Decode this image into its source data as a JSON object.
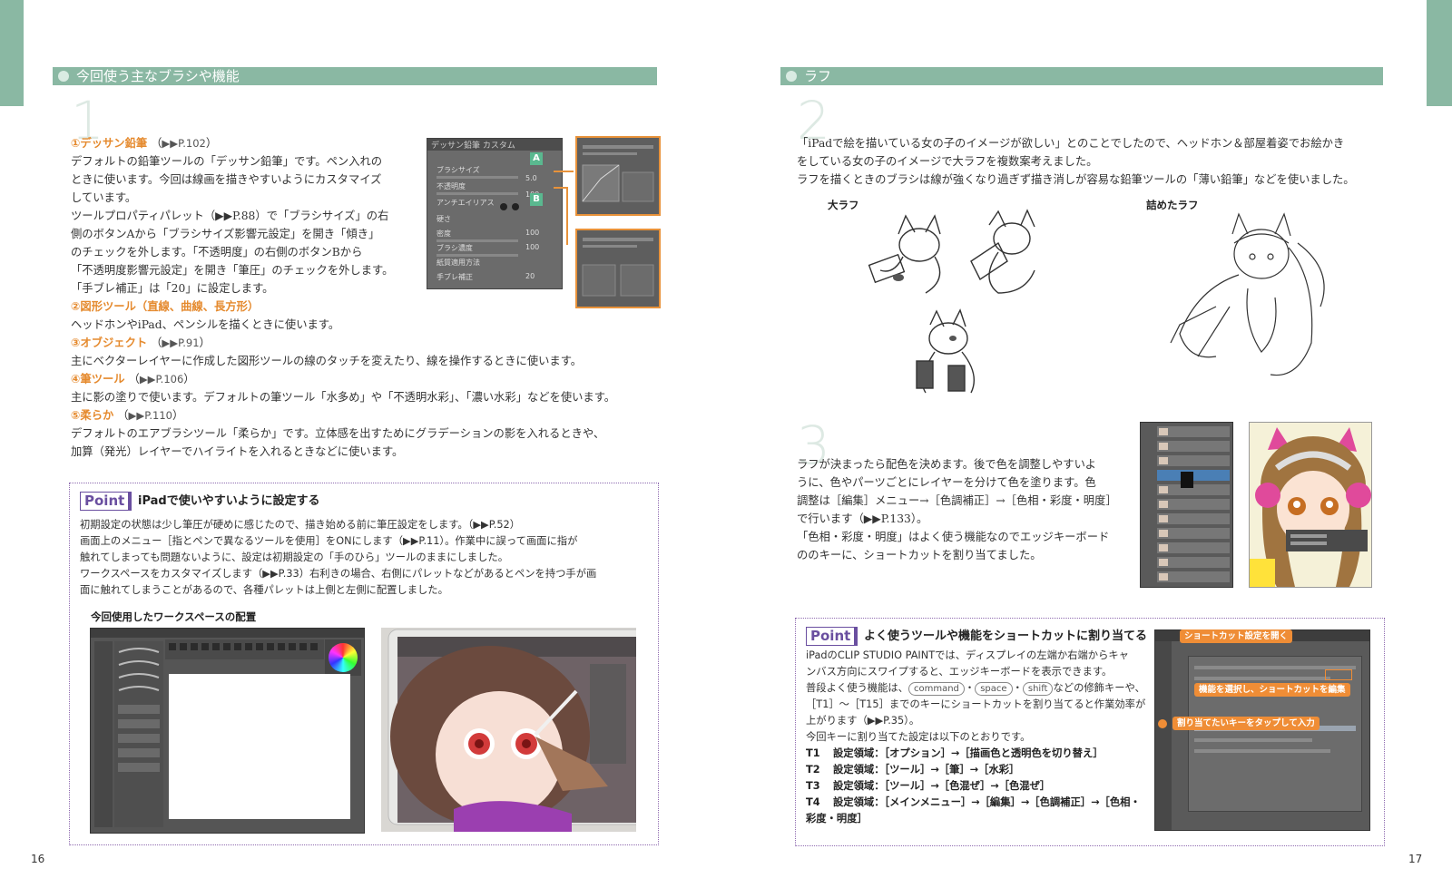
{
  "left": {
    "section_title": "今回使う主なブラシや機能",
    "big_number": "1",
    "items": [
      {
        "title": "①デッサン鉛筆",
        "ref": "▶▶P.102"
      },
      {
        "title": "②図形ツール（直線、曲線、長方形）",
        "ref": ""
      },
      {
        "title": "③オブジェクト",
        "ref": "▶▶P.91"
      },
      {
        "title": "④筆ツール",
        "ref": "▶▶P.106"
      },
      {
        "title": "⑤柔らか",
        "ref": "▶▶P.110"
      }
    ],
    "text_lines": [
      "デフォルトの鉛筆ツールの「デッサン鉛筆」です。ペン入れの",
      "ときに使います。今回は線画を描きやすいようにカスタマイズ",
      "しています。",
      "ツールプロパティパレット（▶▶P.88）で「ブラシサイズ」の右",
      "側のボタンAから「ブラシサイズ影響元設定」を開き「傾き」",
      "のチェックを外します。「不透明度」の右側のボタンBから",
      "「不透明度影響元設定」を開き「筆圧」のチェックを外します。",
      "「手ブレ補正」は「20」に設定します。",
      "ヘッドホンやiPad、ペンシルを描くときに使います。",
      "主にベクターレイヤーに作成した図形ツールの線のタッチを変えたり、線を操作するときに使います。",
      "主に影の塗りで使います。デフォルトの筆ツール「水多め」や「不透明水彩」、「濃い水彩」などを使います。",
      "デフォルトのエアブラシツール「柔らか」です。立体感を出すためにグラデーションの影を入れるときや、",
      "加算（発光）レイヤーでハイライトを入れるときなどに使います。"
    ],
    "panel_labels": {
      "header": "デッサン鉛筆 カスタム",
      "rows": [
        "ブラシサイズ",
        "不透明度",
        "アンチエイリアス",
        "硬さ",
        "密度",
        "ブラシ濃度",
        "紙質適用方法",
        "手ブレ補正"
      ],
      "values": [
        "5.0",
        "100",
        "",
        "",
        "100",
        "100",
        "",
        "20"
      ],
      "badge_a": "A",
      "badge_b": "B"
    },
    "point": {
      "badge": "Point",
      "title": "iPadで使いやすいように設定する",
      "lines": [
        "初期設定の状態は少し筆圧が硬めに感じたので、描き始める前に筆圧設定をします。（▶▶P.52）",
        "画面上のメニュー［指とペンで異なるツールを使用］をONにします（▶▶P.11）。作業中に誤って画面に指が",
        "触れてしまっても問題ないように、設定は初期設定の「手のひら」ツールのままにしました。",
        "ワークスペースをカスタマイズします（▶▶P.33）右利きの場合、右側にパレットなどがあるとペンを持つ手が画",
        "面に触れてしまうことがあるので、各種パレットは上側と左側に配置しました。"
      ],
      "caption": "今回使用したワークスペースの配置"
    },
    "page_number": "16"
  },
  "right": {
    "section_title": "ラフ",
    "big_number_2": "2",
    "big_number_3": "3",
    "intro_lines": [
      "「iPadで絵を描いている女の子のイメージが欲しい」とのことでしたので、ヘッドホン＆部屋着姿でお絵かき",
      "をしている女の子のイメージで大ラフを複数案考えました。",
      "ラフを描くときのブラシは線が強くなり過ぎず描き消しが容易な鉛筆ツールの「薄い鉛筆」などを使いました。"
    ],
    "sketch_label_1": "大ラフ",
    "sketch_label_2": "詰めたラフ",
    "step3_lines": [
      "ラフが決まったら配色を決めます。後で色を調整しやすいよ",
      "うに、色やパーツごとにレイヤーを分けて色を塗ります。色",
      "調整は［編集］メニュー→［色調補正］→［色相・彩度・明度］",
      "で行います（▶▶P.133）。",
      "「色相・彩度・明度」はよく使う機能なのでエッジキーボード",
      "ののキーに、ショートカットを割り当てました。"
    ],
    "point": {
      "badge": "Point",
      "title": "よく使うツールや機能をショートカットに割り当てる",
      "lines": [
        "iPadのCLIP STUDIO PAINTでは、ディスプレイの左端か右端からキャ",
        "ンバス方向にスワイプすると、エッジキーボードを表示できます。",
        "普段よく使う機能は、",
        "［T1］～［T15］までのキーにショートカットを割り当てると作業効率が",
        "上がります（▶▶P.35）。",
        "今回キーに割り当てた設定は以下のとおりです。"
      ],
      "keys": [
        "command",
        "space",
        "shift"
      ],
      "keys_suffix": "などの修飾キーや、",
      "shortcuts": [
        {
          "key": "T1",
          "text": "設定領域：［オプション］→［描画色と透明色を切り替え］"
        },
        {
          "key": "T2",
          "text": "設定領域：［ツール］→［筆］→［水彩］"
        },
        {
          "key": "T3",
          "text": "設定領域：［ツール］→［色混ぜ］→［色混ぜ］"
        },
        {
          "key": "T4",
          "text": "設定領域：［メインメニュー］→［編集］→［色調補正］→［色相・"
        },
        {
          "key": "",
          "text": "彩度・明度］"
        }
      ],
      "callouts": [
        "ショートカット設定を開く",
        "機能を選択し、ショートカットを編集",
        "割り当てたいキーをタップして入力"
      ]
    },
    "page_number": "17"
  }
}
